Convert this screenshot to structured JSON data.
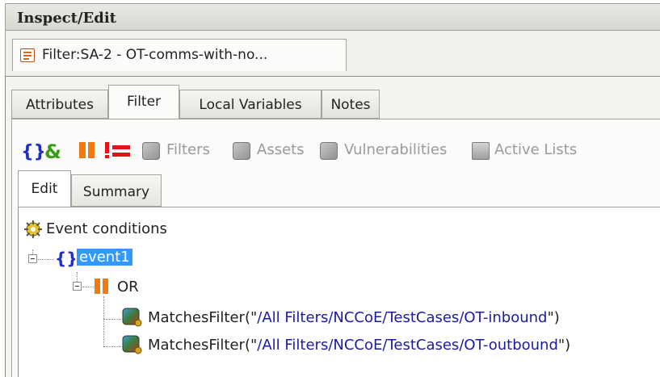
{
  "panel": {
    "title": "Inspect/Edit"
  },
  "document_tab": {
    "label": "Filter:SA-2 - OT-comms-with-no...",
    "icon": "filter-document-icon"
  },
  "main_tabs": [
    {
      "label": "Attributes",
      "active": false
    },
    {
      "label": "Filter",
      "active": true
    },
    {
      "label": "Local Variables",
      "active": false
    },
    {
      "label": "Notes",
      "active": false
    }
  ],
  "toolbar": {
    "icons": {
      "group": "braces-icon",
      "and": "ampersand-icon",
      "or": "or-bars-icon",
      "not": "not-equal-icon"
    },
    "buttons": [
      {
        "label": "Filters",
        "icon": "filter-resource-icon"
      },
      {
        "label": "Assets",
        "icon": "asset-resource-icon"
      },
      {
        "label": "Vulnerabilities",
        "icon": "vulnerability-resource-icon"
      },
      {
        "label": "Active Lists",
        "icon": "active-list-icon"
      }
    ]
  },
  "sub_tabs": [
    {
      "label": "Edit",
      "active": true
    },
    {
      "label": "Summary",
      "active": false
    }
  ],
  "tree": {
    "root_label": "Event conditions",
    "event_label": "event1",
    "or_label": "OR",
    "conditions": [
      {
        "prefix": "MatchesFilter(\"",
        "path": "/All Filters/NCCoE/TestCases/OT-inbound",
        "suffix": "\")"
      },
      {
        "prefix": "MatchesFilter(\"",
        "path": "/All Filters/NCCoE/TestCases/OT-outbound",
        "suffix": "\")"
      }
    ]
  },
  "colors": {
    "selection": "#3399ff",
    "braces": "#1f2fc0",
    "and": "#3a9a1a",
    "or": "#f07a10",
    "not": "#e0141b",
    "path_text": "#1a1aa8"
  }
}
